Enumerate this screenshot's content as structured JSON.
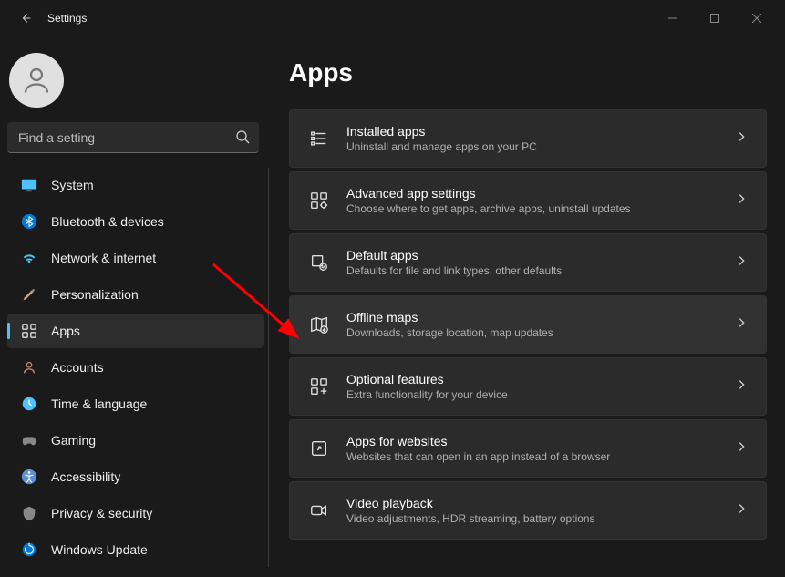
{
  "titlebar": {
    "title": "Settings"
  },
  "search": {
    "placeholder": "Find a setting"
  },
  "nav": {
    "items": [
      {
        "label": "System"
      },
      {
        "label": "Bluetooth & devices"
      },
      {
        "label": "Network & internet"
      },
      {
        "label": "Personalization"
      },
      {
        "label": "Apps"
      },
      {
        "label": "Accounts"
      },
      {
        "label": "Time & language"
      },
      {
        "label": "Gaming"
      },
      {
        "label": "Accessibility"
      },
      {
        "label": "Privacy & security"
      },
      {
        "label": "Windows Update"
      }
    ]
  },
  "page": {
    "title": "Apps",
    "cards": [
      {
        "title": "Installed apps",
        "sub": "Uninstall and manage apps on your PC"
      },
      {
        "title": "Advanced app settings",
        "sub": "Choose where to get apps, archive apps, uninstall updates"
      },
      {
        "title": "Default apps",
        "sub": "Defaults for file and link types, other defaults"
      },
      {
        "title": "Offline maps",
        "sub": "Downloads, storage location, map updates"
      },
      {
        "title": "Optional features",
        "sub": "Extra functionality for your device"
      },
      {
        "title": "Apps for websites",
        "sub": "Websites that can open in an app instead of a browser"
      },
      {
        "title": "Video playback",
        "sub": "Video adjustments, HDR streaming, battery options"
      }
    ]
  }
}
